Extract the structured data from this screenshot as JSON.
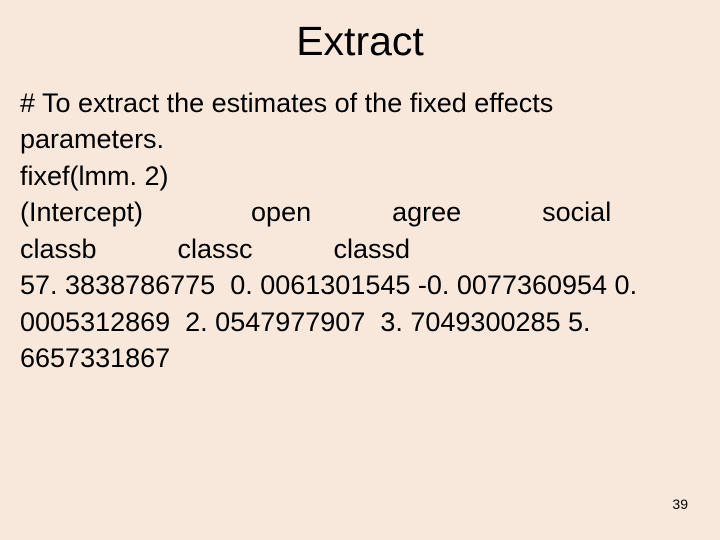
{
  "title": "Extract",
  "lines": [
    "# To extract the estimates of the fixed effects parameters.",
    "fixef(lmm. 2)",
    " (Intercept)    open   agree   social   classb   classc   classd",
    "57. 3838786775  0. 0061301545 -0. 0077360954 0. 0005312869  2. 0547977907  3. 7049300285 5. 6657331867"
  ],
  "pageNumber": "39"
}
